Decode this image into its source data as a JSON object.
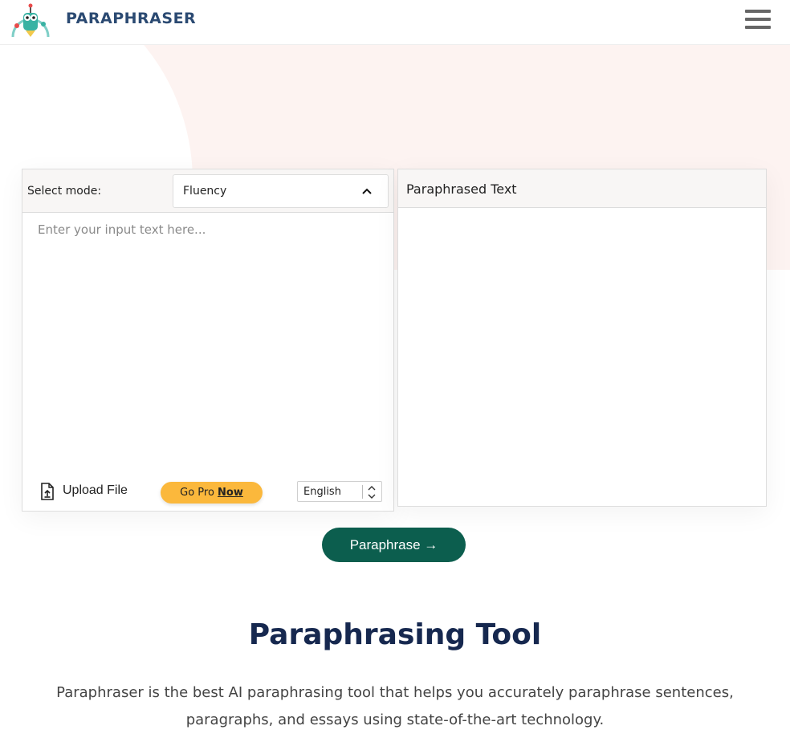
{
  "header": {
    "brand": "PARAPHRASER",
    "logo_icon": "robot-mascot-icon",
    "menu_icon": "hamburger-menu-icon"
  },
  "tool": {
    "mode_label": "Select mode:",
    "mode_value": "Fluency",
    "input_placeholder": "Enter your input text here...",
    "upload_label": "Upload File",
    "upload_icon": "file-upload-icon",
    "go_pro_text": "Go Pro ",
    "go_pro_now": "Now",
    "language": "English",
    "output_title": "Paraphrased Text",
    "output_text": ""
  },
  "cta": {
    "label": "Paraphrase →"
  },
  "content": {
    "title": "Paraphrasing Tool",
    "description": "Paraphraser is the best AI paraphrasing tool that helps you accurately paraphrase sentences, paragraphs, and essays using state-of-the-art technology."
  },
  "colors": {
    "brand": "#2b4a72",
    "cta": "#0c5e4e",
    "go_pro": "#fbb83c",
    "title": "#16284f",
    "hero_bg": "#fdf3f1"
  }
}
